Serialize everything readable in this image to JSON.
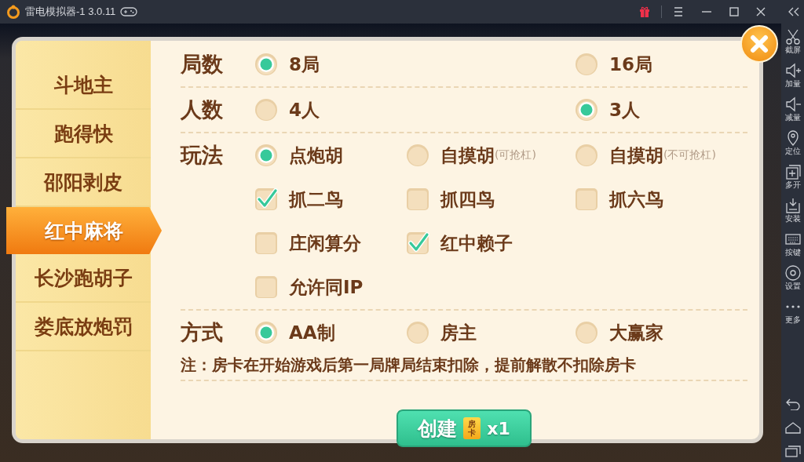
{
  "title_bar": {
    "title": "雷电模拟器-1 3.0.11"
  },
  "dialog": {
    "tabs": [
      {
        "label": "斗地主",
        "selected": false
      },
      {
        "label": "跑得快",
        "selected": false
      },
      {
        "label": "邵阳剥皮",
        "selected": false
      },
      {
        "label": "红中麻将",
        "selected": true
      },
      {
        "label": "长沙跑胡子",
        "selected": false
      },
      {
        "label": "娄底放炮罚",
        "selected": false
      }
    ],
    "sections": [
      {
        "label": "局数",
        "rows": [
          [
            {
              "kind": "radio",
              "label": "8局",
              "selected": true
            },
            null,
            {
              "kind": "radio",
              "label": "16局",
              "selected": false
            }
          ]
        ]
      },
      {
        "label": "人数",
        "rows": [
          [
            {
              "kind": "radio",
              "label": "4人",
              "selected": false
            },
            null,
            {
              "kind": "radio",
              "label": "3人",
              "selected": true
            }
          ]
        ]
      },
      {
        "label": "玩法",
        "rows": [
          [
            {
              "kind": "radio",
              "label": "点炮胡",
              "selected": true
            },
            {
              "kind": "radio",
              "label": "自摸胡",
              "note": "(可抢杠)",
              "selected": false
            },
            {
              "kind": "radio",
              "label": "自摸胡",
              "note": "(不可抢杠)",
              "selected": false
            }
          ],
          [
            {
              "kind": "checkbox",
              "label": "抓二鸟",
              "checked": true
            },
            {
              "kind": "checkbox",
              "label": "抓四鸟",
              "checked": false
            },
            {
              "kind": "checkbox",
              "label": "抓六鸟",
              "checked": false
            }
          ],
          [
            {
              "kind": "checkbox",
              "label": "庄闲算分",
              "checked": false
            },
            {
              "kind": "checkbox",
              "label": "红中赖子",
              "checked": true
            }
          ],
          [
            {
              "kind": "checkbox",
              "label": "允许同IP",
              "checked": false
            }
          ]
        ]
      },
      {
        "label": "方式",
        "rows": [
          [
            {
              "kind": "radio",
              "label": "AA制",
              "selected": true
            },
            {
              "kind": "radio",
              "label": "房主",
              "selected": false
            },
            {
              "kind": "radio",
              "label": "大赢家",
              "selected": false
            }
          ]
        ],
        "note": "注：房卡在开始游戏后第一局牌局结束扣除，提前解散不扣除房卡"
      }
    ],
    "create_button": {
      "label": "创建",
      "card": "房卡",
      "quantity": "x1"
    }
  },
  "side_toolbar": [
    {
      "kind": "scissors",
      "label": "截屏"
    },
    {
      "kind": "volume-up",
      "label": "加量"
    },
    {
      "kind": "volume-down",
      "label": "减量"
    },
    {
      "kind": "location",
      "label": "定位"
    },
    {
      "kind": "multi",
      "label": "多开"
    },
    {
      "kind": "install",
      "label": "安装"
    },
    {
      "kind": "keyboard",
      "label": "按键"
    },
    {
      "kind": "settings",
      "label": "设置"
    },
    {
      "kind": "more",
      "label": "更多"
    }
  ]
}
